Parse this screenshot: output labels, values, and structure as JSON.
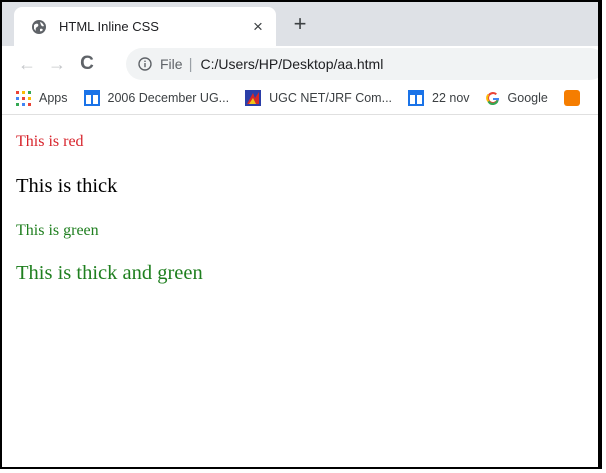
{
  "tab": {
    "title": "HTML Inline CSS",
    "close": "×",
    "new_tab": "+"
  },
  "toolbar": {
    "back": "←",
    "forward": "→",
    "reload": "C",
    "file_label": "File",
    "separator": "|",
    "url": "C:/Users/HP/Desktop/aa.html"
  },
  "bookmarks": [
    {
      "label": "Apps",
      "icon": "apps-grid-icon"
    },
    {
      "label": "2006 December UG...",
      "icon": "page-icon"
    },
    {
      "label": "UGC NET/JRF Com...",
      "icon": "site-favicon"
    },
    {
      "label": "22 nov",
      "icon": "page-icon"
    },
    {
      "label": "Google",
      "icon": "google-icon"
    }
  ],
  "content": {
    "line1": {
      "text": "This is red",
      "color": "#d7242c"
    },
    "line2": {
      "text": "This is thick",
      "color": "#000000"
    },
    "line3": {
      "text": "This is green",
      "color": "#1f7f1f"
    },
    "line4": {
      "text": "This is thick and green",
      "color": "#1f7f1f"
    }
  },
  "colors": {
    "tabstrip": "#dee1e6",
    "omnibox": "#f1f3f4",
    "bookmark_blue": "#1a73e8"
  }
}
